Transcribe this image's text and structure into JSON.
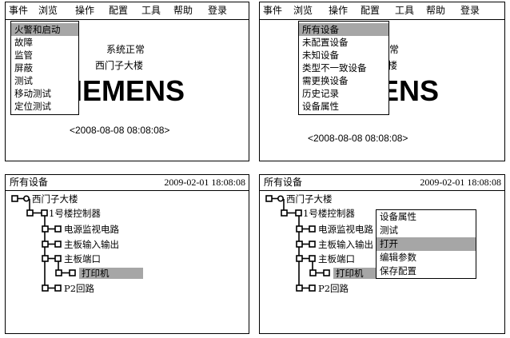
{
  "menu": [
    "事件",
    "浏览",
    "操作",
    "配置",
    "工具",
    "帮助",
    "登录"
  ],
  "event_menu": [
    "火警和启动",
    "故障",
    "监管",
    "屏蔽",
    "测试",
    "移动测试",
    "定位测试"
  ],
  "browse_menu": [
    "所有设备",
    "未配置设备",
    "未知设备",
    "类型不一致设备",
    "需更换设备",
    "历史记录",
    "设备属性"
  ],
  "status_text": "系统正常",
  "location_text": "西门子大楼",
  "logo_text": "SIEMENS",
  "datetime": "<2008-08-08   08:08:08>",
  "tree_title": "所有设备",
  "tree_datetime": "2009-02-01  18:08:08",
  "tree": {
    "root": "西门子大楼",
    "controller": "1号楼控制器",
    "item1": "电源监视电路",
    "item2": "主板输入输出",
    "item3": "主板端口",
    "item4": "打印机",
    "item5": "P2回路"
  },
  "context_menu": [
    "设备属性",
    "测试",
    "打开",
    "编辑参数",
    "保存配置"
  ],
  "colors": {
    "highlight": "#a6a6a6",
    "border": "#000000"
  }
}
